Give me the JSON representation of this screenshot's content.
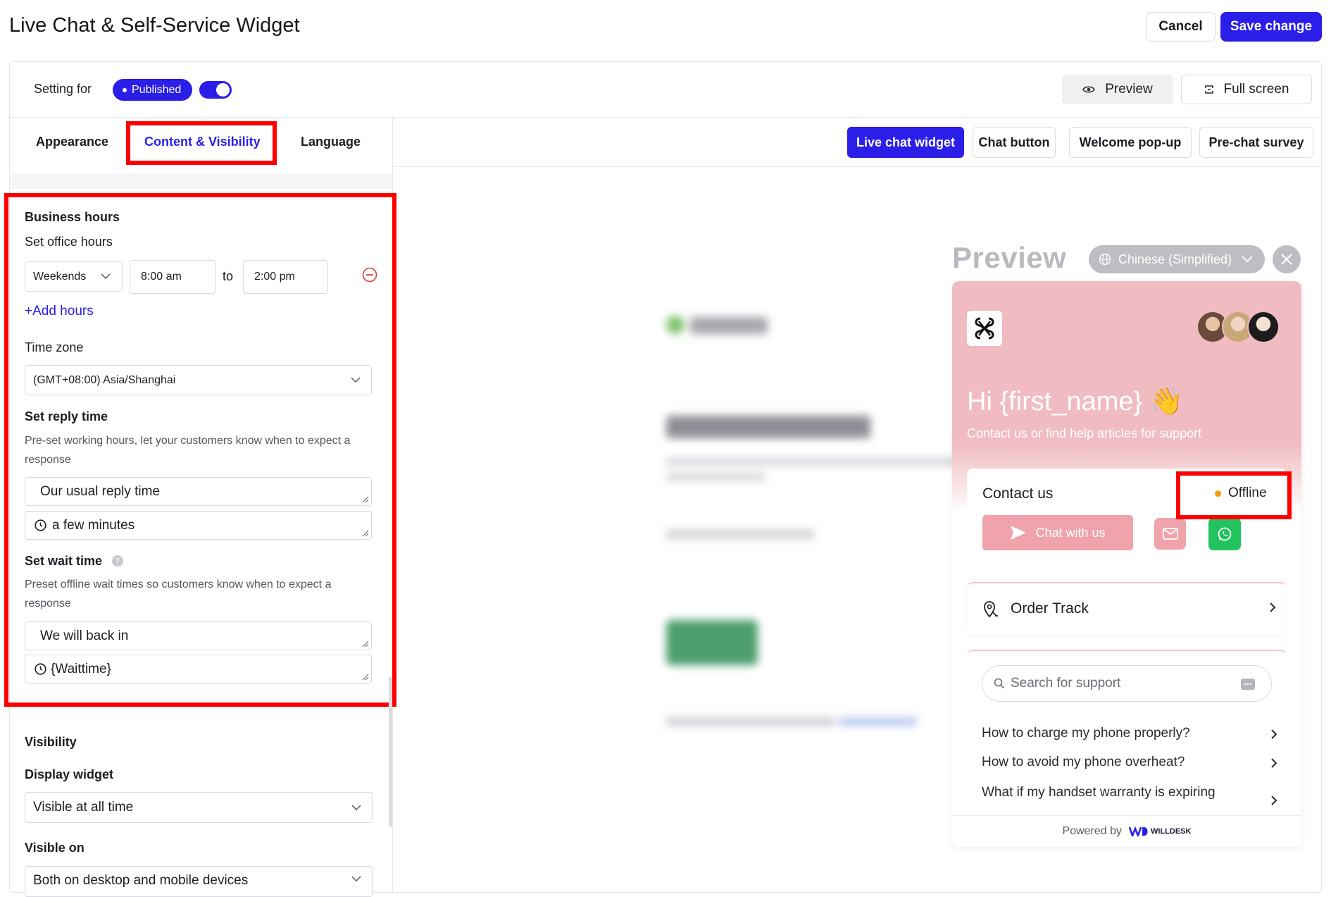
{
  "header": {
    "title": "Live Chat & Self-Service Widget",
    "cancel_label": "Cancel",
    "save_label": "Save change"
  },
  "settings_bar": {
    "setting_for_label": "Setting for",
    "status_pill": "Published",
    "toggle_on": true,
    "preview_label": "Preview",
    "fullscreen_label": "Full screen"
  },
  "left_tabs": [
    {
      "label": "Appearance",
      "active": false
    },
    {
      "label": "Content & Visibility",
      "active": true
    },
    {
      "label": "Language",
      "active": false
    }
  ],
  "right_tabs": [
    {
      "label": "Live chat widget",
      "active": true
    },
    {
      "label": "Chat button",
      "active": false
    },
    {
      "label": "Welcome pop-up",
      "active": false
    },
    {
      "label": "Pre-chat survey",
      "active": false
    }
  ],
  "business_hours": {
    "section_title": "Business hours",
    "office_hours_label": "Set office hours",
    "day_select": "Weekends",
    "start_time": "8:00 am",
    "to_label": "to",
    "end_time": "2:00 pm",
    "add_hours_label": "+Add hours",
    "timezone_label": "Time zone",
    "timezone_value": "(GMT+08:00) Asia/Shanghai",
    "reply_time_title": "Set reply time",
    "reply_time_desc": "Pre-set working hours, let your customers know when to expect a response",
    "reply_text": "Our usual reply time",
    "reply_value": "a few minutes",
    "wait_time_title": "Set wait time",
    "wait_time_desc": "Preset offline wait times so customers know when to expect a response",
    "wait_text": "We will back in",
    "wait_value": "{Waittime}"
  },
  "visibility": {
    "section_title": "Visibility",
    "display_widget_label": "Display widget",
    "display_widget_value": "Visible at all time",
    "visible_on_label": "Visible on",
    "visible_on_value": "Both on desktop and mobile devices"
  },
  "preview_panel": {
    "title": "Preview",
    "language": "Chinese (Simplified)",
    "greeting": "Hi {first_name} 👋",
    "sub_greeting": "Contact us or find help articles for support",
    "contact_title": "Contact us",
    "status": "Offline",
    "chat_button_label": "Chat with us",
    "order_track_label": "Order Track",
    "search_placeholder": "Search for support",
    "faqs": [
      "How to charge my phone properly?",
      "How to avoid my phone overheat?",
      "What if my handset warranty is expiring"
    ],
    "powered_by": "Powered by",
    "brand": "WILLDESK"
  },
  "colors": {
    "accent": "#2a1ee8",
    "widget_pink": "#f0bcc1",
    "button_pink": "#f0a3aa",
    "whatsapp_green": "#22c35e",
    "offline_dot": "#f79b0d",
    "highlight_red": "#ff0000"
  }
}
